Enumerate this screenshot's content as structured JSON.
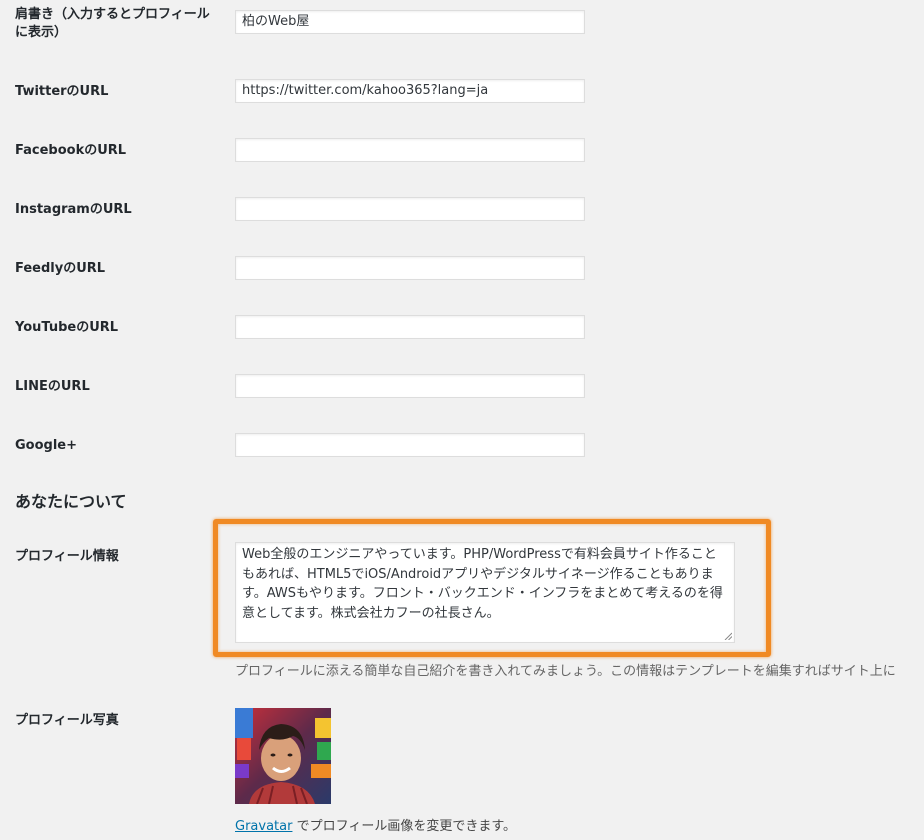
{
  "fields": [
    {
      "label": "肩書き（入力するとプロフィールに表示）",
      "value": "柏のWeb屋"
    },
    {
      "label": "TwitterのURL",
      "value": "https://twitter.com/kahoo365?lang=ja"
    },
    {
      "label": "FacebookのURL",
      "value": ""
    },
    {
      "label": "InstagramのURL",
      "value": ""
    },
    {
      "label": "FeedlyのURL",
      "value": ""
    },
    {
      "label": "YouTubeのURL",
      "value": ""
    },
    {
      "label": "LINEのURL",
      "value": ""
    },
    {
      "label": "Google+",
      "value": ""
    }
  ],
  "about_section": {
    "title": "あなたについて",
    "bio_label": "プロフィール情報",
    "bio_value": "Web全般のエンジニアやっています。PHP/WordPressで有料会員サイト作ることもあれば、HTML5でiOS/Androidアプリやデジタルサイネージ作ることもあります。AWSもやります。フロント・バックエンド・インフラをまとめて考えるのを得意としてます。株式会社カフーの社長さん。",
    "bio_description": "プロフィールに添える簡単な自己紹介を書き入れてみましょう。この情報はテンプレートを編集すればサイト上に",
    "photo_label": "プロフィール写真",
    "gravatar_link": "Gravatar",
    "photo_caption": "でプロフィール画像を変更できます。"
  },
  "colors": {
    "background": "#f1f1f1",
    "highlight": "#f08a24",
    "link": "#0073aa"
  }
}
